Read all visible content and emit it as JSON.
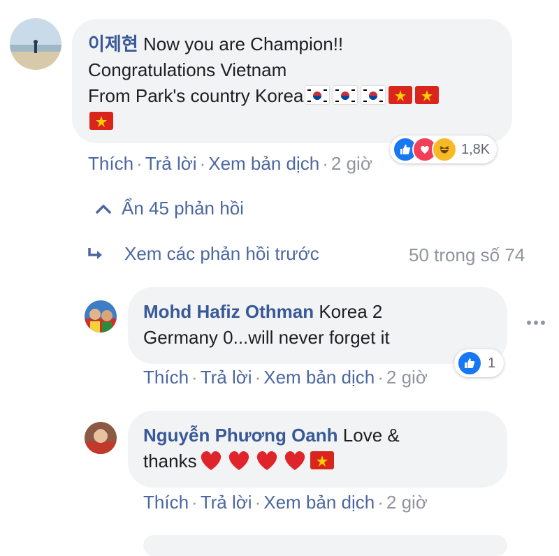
{
  "comments": [
    {
      "author": "이제현",
      "line1": "Now you are Champion!!",
      "line2": "Congratulations Vietnam",
      "line3": "From Park's country Korea",
      "actions": {
        "like": "Thích",
        "reply": "Trả lời",
        "translate": "Xem bản dịch",
        "time": "2 giờ"
      },
      "reaction_count": "1,8K",
      "reaction_icons": [
        "like-icon",
        "love-icon",
        "haha-icon"
      ],
      "emoji_flags": [
        "korea-flag",
        "korea-flag",
        "korea-flag",
        "vietnam-flag",
        "vietnam-flag",
        "vietnam-flag"
      ]
    }
  ],
  "thread": {
    "hide_replies": "Ẩn 45 phản hồi",
    "view_previous": "Xem các phản hồi trước",
    "progress": "50 trong số 74"
  },
  "replies": [
    {
      "author": "Mohd Hafiz Othman",
      "text_a": "Korea 2",
      "text_b": "Germany 0...will never forget it",
      "actions": {
        "like": "Thích",
        "reply": "Trả lời",
        "translate": "Xem bản dịch",
        "time": "2 giờ"
      },
      "reaction_count": "1",
      "reaction_icons": [
        "like-icon"
      ]
    },
    {
      "author": "Nguyễn Phương Oanh",
      "text_a": "Love &",
      "text_b": "thanks",
      "actions": {
        "like": "Thích",
        "reply": "Trả lời",
        "translate": "Xem bản dịch",
        "time": "2 giờ"
      },
      "emoji": [
        "heart-emoji",
        "heart-emoji",
        "heart-emoji",
        "heart-emoji",
        "vietnam-flag"
      ]
    }
  ],
  "colors": {
    "link": "#4b67a1",
    "author": "#385898",
    "bubble": "#f2f3f5",
    "muted": "#90949c",
    "like_blue": "#1877f2",
    "love_red": "#f33e58",
    "haha_yellow": "#f7b928"
  }
}
